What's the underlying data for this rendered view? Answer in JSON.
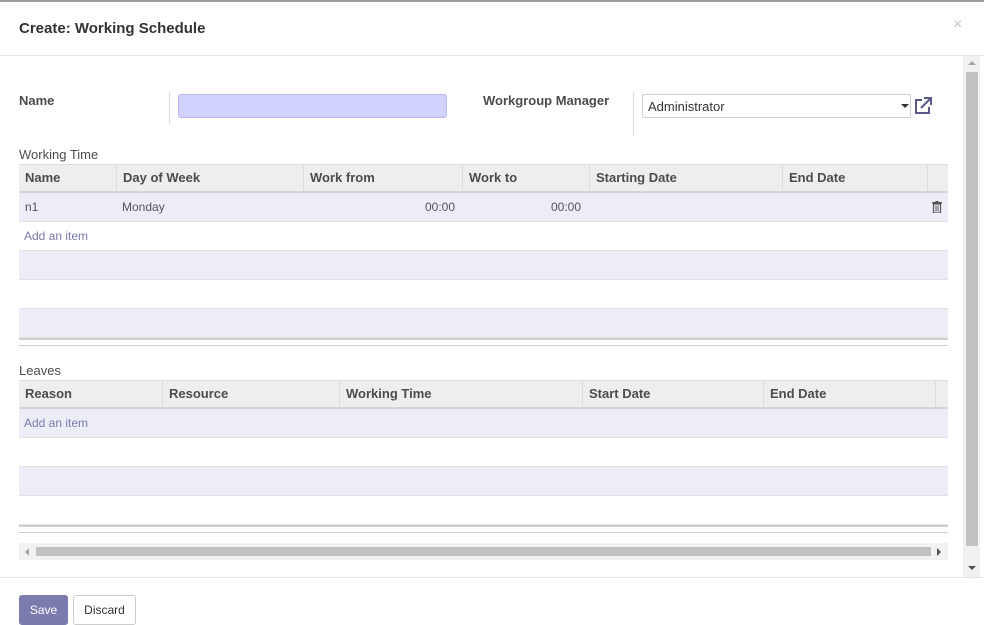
{
  "dialog": {
    "title": "Create: Working Schedule",
    "close_glyph": "×"
  },
  "form": {
    "name_label": "Name",
    "name_value": "",
    "manager_label": "Workgroup Manager",
    "manager_value": "Administrator"
  },
  "working_time": {
    "section_label": "Working Time",
    "columns": [
      "Name",
      "Day of Week",
      "Work from",
      "Work to",
      "Starting Date",
      "End Date"
    ],
    "rows": [
      {
        "name": "n1",
        "day": "Monday",
        "work_from": "00:00",
        "work_to": "00:00",
        "start_date": "",
        "end_date": ""
      }
    ],
    "add_item": "Add an item"
  },
  "leaves": {
    "section_label": "Leaves",
    "columns": [
      "Reason",
      "Resource",
      "Working Time",
      "Start Date",
      "End Date"
    ],
    "add_item": "Add an item"
  },
  "footer": {
    "save_label": "Save",
    "discard_label": "Discard"
  },
  "colors": {
    "accent": "#7c7bad",
    "required_field": "#d2d2ff",
    "row_alt": "#ededf7"
  },
  "icons": {
    "close": "close-icon",
    "dropdown": "caret-down-icon",
    "external": "external-link-icon",
    "delete": "trash-icon"
  }
}
